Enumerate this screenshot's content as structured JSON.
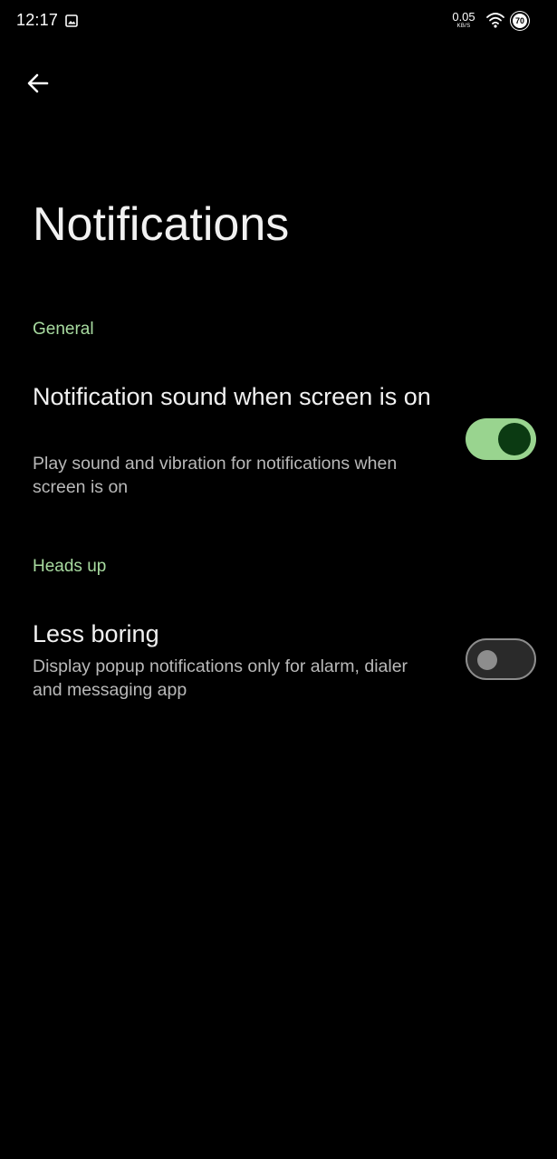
{
  "status_bar": {
    "time": "12:17",
    "net_speed_value": "0.05",
    "net_speed_unit": "KB/S",
    "battery_level": "70",
    "icons": [
      "image-icon",
      "wifi-icon",
      "battery-icon"
    ]
  },
  "header": {
    "back_icon": "arrow-left-icon",
    "title": "Notifications"
  },
  "sections": [
    {
      "header": "General",
      "preferences": [
        {
          "title": "Notification sound when screen is on",
          "summary": "Play sound and vibration for notifications when screen is on",
          "checked": true
        }
      ]
    },
    {
      "header": "Heads up",
      "preferences": [
        {
          "title": "Less boring",
          "summary": "Display popup notifications only for alarm, dialer and messaging app",
          "checked": false
        }
      ]
    }
  ],
  "colors": {
    "background": "#000000",
    "accent": "#a8dba0",
    "switch_on_track": "#99d48f",
    "switch_on_thumb": "#0b3a12",
    "switch_off_outline": "#8d8d8d"
  }
}
